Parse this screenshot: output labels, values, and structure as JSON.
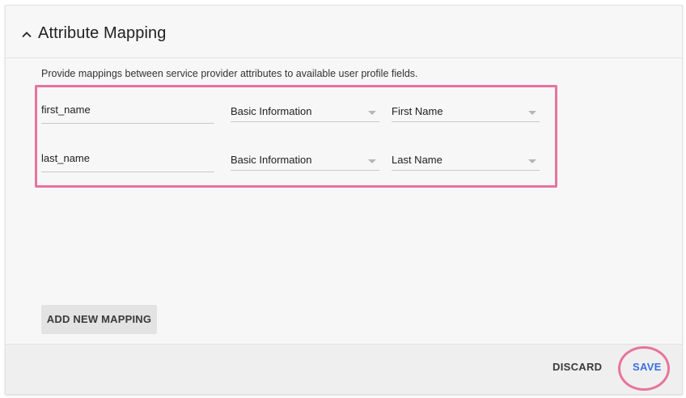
{
  "section": {
    "title": "Attribute Mapping",
    "description": "Provide mappings between service provider attributes to available user profile fields."
  },
  "mappings": [
    {
      "attribute": "first_name",
      "category": "Basic Information",
      "profile_field": "First Name"
    },
    {
      "attribute": "last_name",
      "category": "Basic Information",
      "profile_field": "Last Name"
    }
  ],
  "actions": {
    "add_mapping_label": "ADD NEW MAPPING",
    "discard_label": "DISCARD",
    "save_label": "SAVE"
  },
  "icons": {
    "collapse": "chevron-up-icon",
    "dropdown": "dropdown-arrow-icon"
  },
  "colors": {
    "highlight": "#e8739d",
    "save_text": "#3a6fe0",
    "card_background": "#f7f7f7",
    "footer_background": "#efefef"
  }
}
